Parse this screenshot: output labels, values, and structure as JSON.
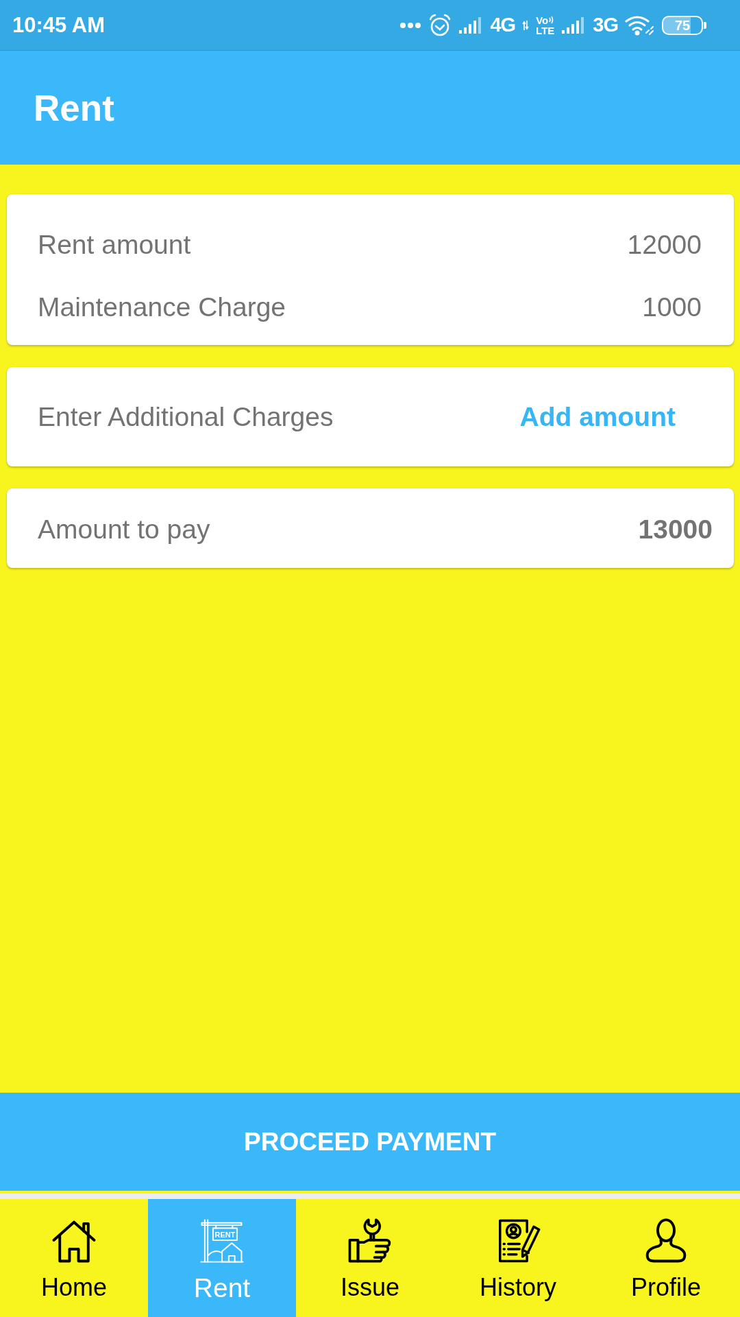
{
  "status_bar": {
    "time": "10:45 AM",
    "network_1": "4G",
    "volte": {
      "top": "Vo",
      "bottom": "LTE"
    },
    "network_2": "3G",
    "battery": "75"
  },
  "app_bar": {
    "title": "Rent"
  },
  "charges": [
    {
      "label": "Rent amount",
      "value": "12000"
    },
    {
      "label": "Maintenance Charge",
      "value": "1000"
    }
  ],
  "additional_charges": {
    "label": "Enter Additional Charges",
    "action": "Add amount"
  },
  "total": {
    "label": "Amount to pay",
    "value": "13000"
  },
  "primary_button": {
    "label": "PROCEED PAYMENT"
  },
  "bottom_nav": [
    {
      "kind": "home",
      "label": "Home",
      "selected": false
    },
    {
      "kind": "rent",
      "label": "Rent",
      "selected": true,
      "sign_text": "RENT"
    },
    {
      "kind": "issue",
      "label": "Issue",
      "selected": false
    },
    {
      "kind": "history",
      "label": "History",
      "selected": false
    },
    {
      "kind": "profile",
      "label": "Profile",
      "selected": false
    }
  ]
}
